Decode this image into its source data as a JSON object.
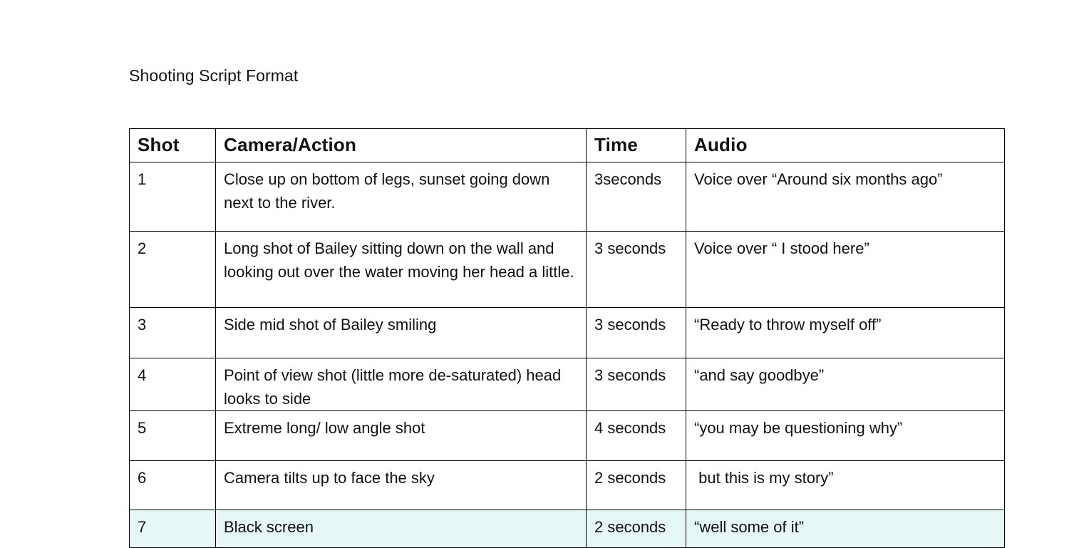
{
  "document": {
    "title": "Shooting Script Format"
  },
  "table": {
    "columns": [
      {
        "key": "shot",
        "label": "Shot"
      },
      {
        "key": "camera",
        "label": "Camera/Action"
      },
      {
        "key": "time",
        "label": "Time"
      },
      {
        "key": "audio",
        "label": "Audio"
      }
    ],
    "highlight_color": "#e6f7f7",
    "rows": [
      {
        "shot": "1",
        "camera": "Close up on bottom of legs, sunset going down next to the river.",
        "time": "3seconds",
        "audio": "Voice over “Around six months ago”",
        "highlighted": false
      },
      {
        "shot": "2",
        "camera": "Long shot of Bailey sitting down on the wall and looking out over the water moving her head a little.",
        "time": "3 seconds",
        "audio": "Voice over “ I stood here”",
        "highlighted": false
      },
      {
        "shot": "3",
        "camera": "Side mid shot of Bailey smiling",
        "time": "3 seconds",
        "audio": "“Ready to throw myself off”",
        "highlighted": false
      },
      {
        "shot": "4",
        "camera": "Point of view shot (little more de-saturated) head looks to side",
        "time": "3 seconds",
        "audio": "“and say goodbye”",
        "highlighted": false
      },
      {
        "shot": "5",
        "camera": "Extreme long/ low angle shot",
        "time": "4 seconds",
        "audio": "“you may be questioning why”",
        "highlighted": false
      },
      {
        "shot": "6",
        "camera": "Camera tilts up to face the sky",
        "time": "2 seconds",
        "audio": " but this is my story”",
        "highlighted": false
      },
      {
        "shot": "7",
        "camera": "Black screen",
        "time": "2 seconds",
        "audio": "“well some of it”",
        "highlighted": true
      }
    ]
  }
}
